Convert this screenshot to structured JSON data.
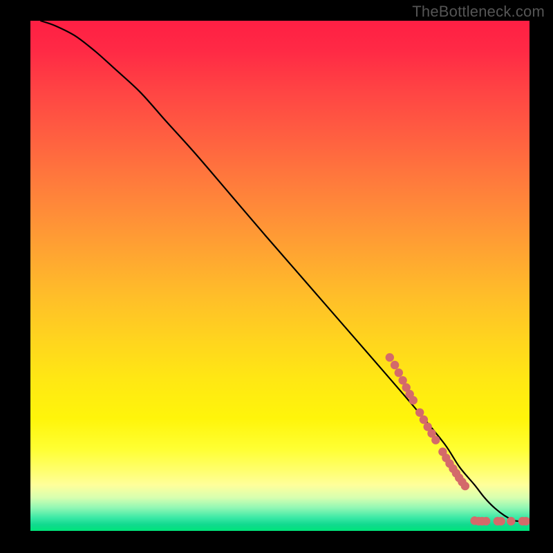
{
  "attribution": "TheBottleneck.com",
  "gradient": {
    "stops": [
      {
        "offset": 0.0,
        "color": "#ff1f44"
      },
      {
        "offset": 0.06,
        "color": "#ff2a45"
      },
      {
        "offset": 0.14,
        "color": "#ff4544"
      },
      {
        "offset": 0.22,
        "color": "#ff5d41"
      },
      {
        "offset": 0.3,
        "color": "#ff763d"
      },
      {
        "offset": 0.38,
        "color": "#ff8e38"
      },
      {
        "offset": 0.46,
        "color": "#ffa631"
      },
      {
        "offset": 0.54,
        "color": "#ffbe29"
      },
      {
        "offset": 0.62,
        "color": "#ffd31f"
      },
      {
        "offset": 0.7,
        "color": "#ffe714"
      },
      {
        "offset": 0.78,
        "color": "#fff50a"
      },
      {
        "offset": 0.84,
        "color": "#ffff33"
      },
      {
        "offset": 0.88,
        "color": "#ffff6b"
      },
      {
        "offset": 0.91,
        "color": "#ffff9b"
      },
      {
        "offset": 0.935,
        "color": "#d7ffb0"
      },
      {
        "offset": 0.955,
        "color": "#90f7b4"
      },
      {
        "offset": 0.975,
        "color": "#38e8a5"
      },
      {
        "offset": 0.988,
        "color": "#10d98e"
      },
      {
        "offset": 1.0,
        "color": "#00e57a"
      }
    ]
  },
  "chart_data": {
    "type": "line",
    "title": "",
    "xlabel": "",
    "ylabel": "",
    "xlim": [
      0,
      100
    ],
    "ylim": [
      0,
      100
    ],
    "series": [
      {
        "name": "curve",
        "x": [
          2,
          5,
          9,
          13,
          17,
          22,
          27,
          33,
          40,
          47,
          55,
          63,
          71,
          78,
          83,
          86,
          89,
          91,
          93,
          95,
          97,
          99,
          100
        ],
        "y": [
          100,
          99,
          97,
          94,
          90.5,
          86,
          80.5,
          74,
          66,
          58,
          49,
          40,
          31,
          23,
          17,
          12.5,
          9,
          6.5,
          4.5,
          3,
          2,
          1.9,
          1.9
        ]
      }
    ],
    "markers": {
      "name": "highlighted-points",
      "color": "#d46a6a",
      "points": [
        {
          "x": 72,
          "y": 34
        },
        {
          "x": 73,
          "y": 32.5
        },
        {
          "x": 73.8,
          "y": 31
        },
        {
          "x": 74.6,
          "y": 29.5
        },
        {
          "x": 75.3,
          "y": 28.1
        },
        {
          "x": 76.0,
          "y": 26.8
        },
        {
          "x": 76.7,
          "y": 25.6
        },
        {
          "x": 78.0,
          "y": 23.2
        },
        {
          "x": 78.8,
          "y": 21.8
        },
        {
          "x": 79.6,
          "y": 20.4
        },
        {
          "x": 80.4,
          "y": 19.1
        },
        {
          "x": 81.2,
          "y": 17.8
        },
        {
          "x": 82.6,
          "y": 15.5
        },
        {
          "x": 83.3,
          "y": 14.3
        },
        {
          "x": 84.0,
          "y": 13.2
        },
        {
          "x": 84.7,
          "y": 12.2
        },
        {
          "x": 85.3,
          "y": 11.3
        },
        {
          "x": 85.9,
          "y": 10.4
        },
        {
          "x": 86.5,
          "y": 9.6
        },
        {
          "x": 87.1,
          "y": 8.8
        },
        {
          "x": 89.0,
          "y": 2.0
        },
        {
          "x": 89.8,
          "y": 1.9
        },
        {
          "x": 90.5,
          "y": 1.9
        },
        {
          "x": 91.3,
          "y": 1.9
        },
        {
          "x": 93.6,
          "y": 1.9
        },
        {
          "x": 94.3,
          "y": 1.9
        },
        {
          "x": 96.3,
          "y": 1.9
        },
        {
          "x": 98.6,
          "y": 1.9
        },
        {
          "x": 99.3,
          "y": 1.9
        }
      ]
    }
  },
  "colors": {
    "curve": "#000000",
    "marker": "#d46a6a",
    "frame_bg": "#000000"
  }
}
